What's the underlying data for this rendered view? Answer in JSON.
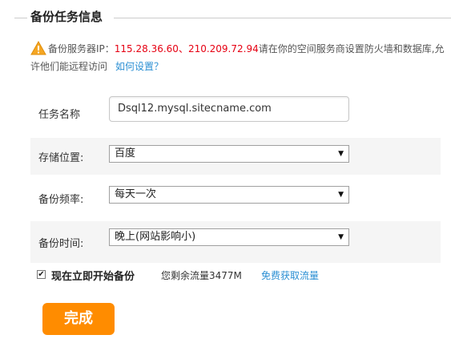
{
  "section": {
    "title": "备份任务信息"
  },
  "notice": {
    "prefix": "备份服务器IP：",
    "ips": "115.28.36.60、210.209.72.94",
    "suffix": "请在你的空间服务商设置防火墙和数据库,允许他们能远程访问",
    "link": "如何设置？"
  },
  "form": {
    "task_name": {
      "label": "任务名称",
      "value": "Dsql12.mysql.sitecname.com"
    },
    "storage": {
      "label": "存储位置:",
      "value": "百度"
    },
    "frequency": {
      "label": "备份频率:",
      "value": "每天一次"
    },
    "time": {
      "label": "备份时间:",
      "value": "晚上(网站影响小)"
    }
  },
  "start_now": {
    "checked": true,
    "label": "现在立即开始备份",
    "quota": "您剩余流量3477M",
    "quota_link": "免费获取流量"
  },
  "done_button": {
    "label": "完成"
  },
  "colors": {
    "accent": "#ff8c00",
    "ip": "#e60012",
    "link": "#2b8fd3"
  }
}
